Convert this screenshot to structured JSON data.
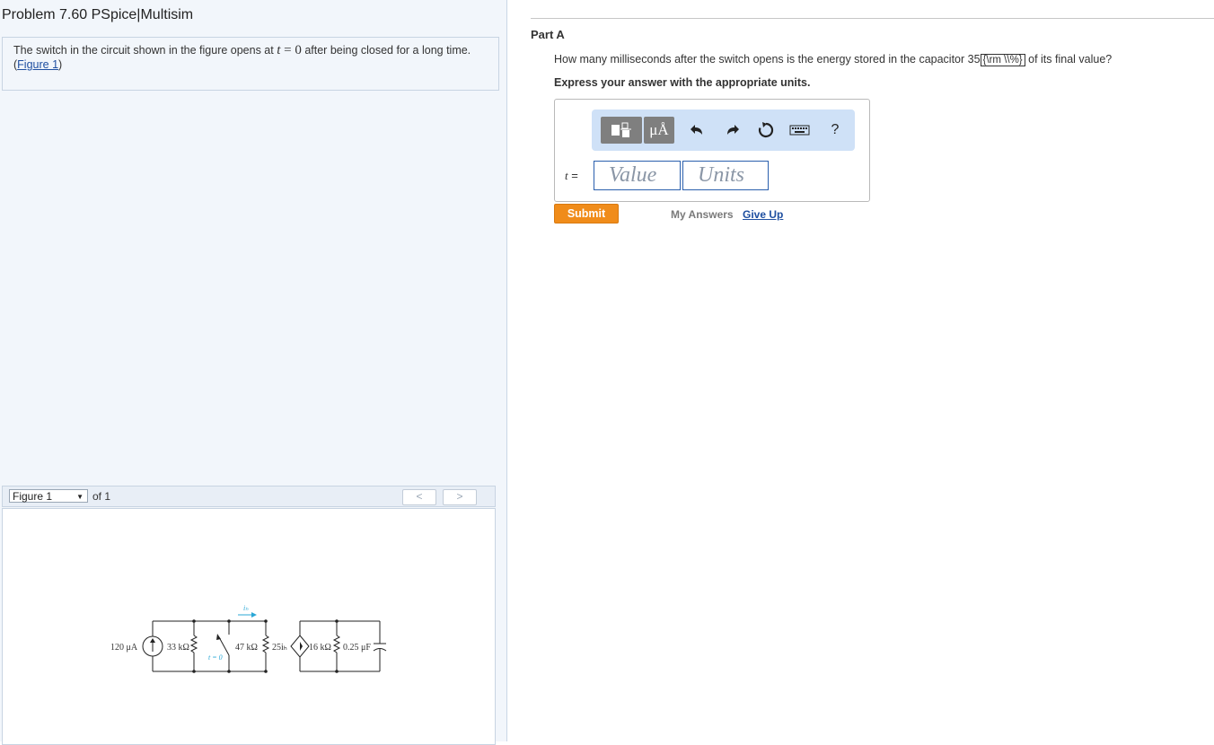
{
  "problem": {
    "title": "Problem 7.60 PSpice|Multisim",
    "intro_before": "The switch in the circuit shown in the figure opens at ",
    "intro_var": "t",
    "intro_eq": " = 0",
    "intro_after": " after being closed for a long time. (",
    "figure_link": "Figure 1",
    "intro_end": ")"
  },
  "figure": {
    "select_value": "Figure 1",
    "of_label": "of 1",
    "prev": "<",
    "next": ">",
    "circuit_labels": {
      "source": "120 μA",
      "r1": "33 kΩ",
      "switch_time": "t = 0",
      "current": "iₕ",
      "r2": "47 kΩ",
      "dep_source": "25iₕ",
      "r3": "16 kΩ",
      "cap": "0.25 μF"
    }
  },
  "part": {
    "label": "Part A",
    "question_before": "How many milliseconds after the switch opens is the energy stored in the capacitor 35",
    "question_boxed": "{\\rm \\\\%}",
    "question_after": " of its final value?",
    "express": "Express your answer with the appropriate units."
  },
  "answer": {
    "toolbar": {
      "templates_icon": "fraction-template-icon",
      "units_label": "μÅ",
      "undo_icon": "undo-icon",
      "redo_icon": "redo-icon",
      "reset_icon": "reset-icon",
      "keyboard_icon": "keyboard-icon",
      "help_label": "?"
    },
    "var_label": "t",
    "eq_sign": " =",
    "value_placeholder": "Value",
    "units_placeholder": "Units"
  },
  "actions": {
    "submit": "Submit",
    "my_answers": "My Answers",
    "give_up": "Give Up"
  },
  "colors": {
    "submit": "#f08c1a",
    "link": "#1f4fa0",
    "toolbar_bg": "#cfe1f7",
    "left_bg": "#f2f6fb"
  }
}
